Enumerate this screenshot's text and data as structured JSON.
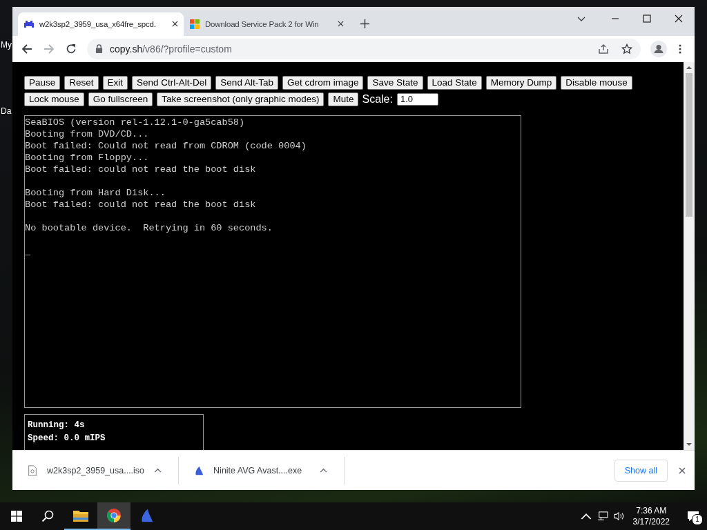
{
  "desktop": {
    "icon_labels": [
      "My",
      "Da"
    ]
  },
  "browser": {
    "tabs": [
      {
        "title": "w2k3sp2_3959_usa_x64fre_spcd.",
        "selected": true,
        "kind": "emulator"
      },
      {
        "title": "Download Service Pack 2 for Win",
        "selected": false,
        "kind": "windows"
      }
    ],
    "address": {
      "host": "copy.sh",
      "path": "/v86/?profile=custom"
    }
  },
  "page": {
    "buttons": [
      {
        "label": "Pause"
      },
      {
        "label": "Reset"
      },
      {
        "label": "Exit"
      },
      {
        "label": "Send Ctrl-Alt-Del"
      },
      {
        "label": "Send Alt-Tab"
      },
      {
        "label": "Get cdrom image"
      },
      {
        "label": "Save State"
      },
      {
        "label": "Load State"
      },
      {
        "label": "Memory Dump"
      },
      {
        "label": "Disable mouse"
      },
      {
        "label": "Lock mouse"
      },
      {
        "label": "Go fullscreen"
      },
      {
        "label": "Take screenshot (only graphic modes)"
      },
      {
        "label": "Mute"
      }
    ],
    "scale": {
      "label": "Scale:",
      "value": "1.0"
    },
    "screen": {
      "paragraphs": [
        [
          "SeaBIOS (version rel-1.12.1-0-ga5cab58)",
          "Booting from DVD/CD...",
          "Boot failed: Could not read from CDROM (code 0004)",
          "Booting from Floppy...",
          "Boot failed: could not read the boot disk"
        ],
        [
          "Booting from Hard Disk...",
          "Boot failed: could not read the boot disk"
        ],
        [
          "No bootable device.  Retrying in 60 seconds."
        ]
      ],
      "cursor": "_"
    },
    "stats": [
      "Running: 4s",
      "Speed: 0.0 mIPS"
    ]
  },
  "downloads": {
    "items": [
      {
        "name": "w2k3sp2_3959_usa....iso",
        "kind": "file"
      },
      {
        "name": "Ninite AVG Avast....exe",
        "kind": "installer"
      }
    ],
    "show_all": "Show all"
  },
  "taskbar": {
    "apps": [
      {
        "kind": "folder",
        "active": false
      },
      {
        "kind": "chrome",
        "active": true
      },
      {
        "kind": "installer",
        "active": false
      }
    ],
    "time": "7:36 AM",
    "date": "3/17/2022",
    "notifications": "1"
  }
}
